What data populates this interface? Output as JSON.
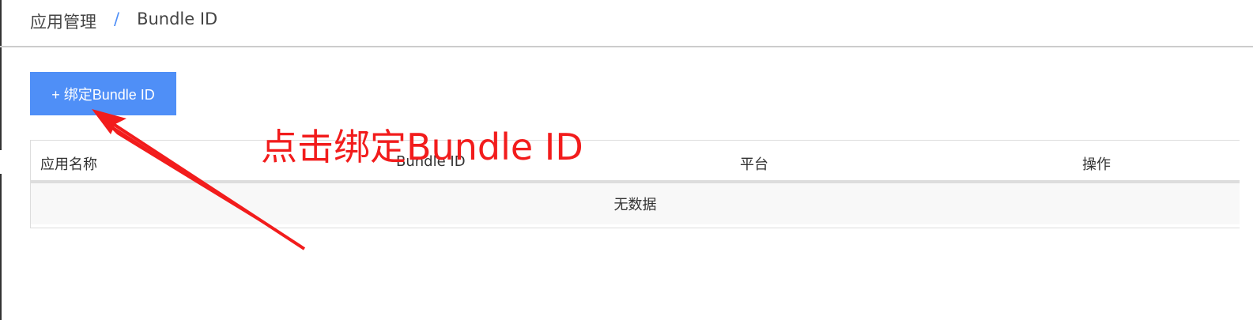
{
  "breadcrumb": {
    "parent": "应用管理",
    "separator": "/",
    "current": "Bundle ID"
  },
  "toolbar": {
    "bind_label": "+ 绑定Bundle ID"
  },
  "table": {
    "columns": [
      "应用名称",
      "Bundle ID",
      "平台",
      "操作"
    ],
    "empty_text": "无数据"
  },
  "annotation": {
    "text": "点击绑定Bundle ID",
    "color": "#f21c1c"
  },
  "colors": {
    "accent": "#4f8ff7"
  }
}
